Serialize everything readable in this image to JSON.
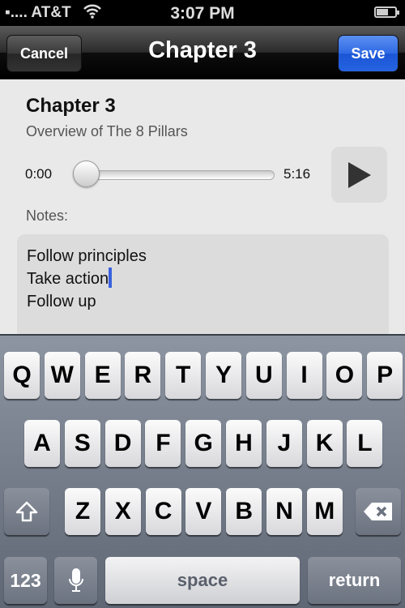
{
  "status_bar": {
    "carrier": "▪.... AT&T",
    "wifi_icon": "wifi-icon",
    "time": "3:07 PM",
    "battery_icon": "battery-icon"
  },
  "navbar": {
    "title": "Chapter 3",
    "cancel_label": "Cancel",
    "save_label": "Save",
    "save_color": "#2563e0"
  },
  "chapter": {
    "title": "Chapter 3",
    "subtitle": "Overview of The 8 Pillars"
  },
  "player": {
    "current_time": "0:00",
    "duration": "5:16",
    "progress": 0,
    "play_icon": "play-icon"
  },
  "notes": {
    "label": "Notes:",
    "lines": [
      "Follow principles",
      "Take action",
      "Follow up"
    ]
  },
  "keyboard": {
    "rows": [
      [
        "Q",
        "W",
        "E",
        "R",
        "T",
        "Y",
        "U",
        "I",
        "O",
        "P"
      ],
      [
        "A",
        "S",
        "D",
        "F",
        "G",
        "H",
        "J",
        "K",
        "L"
      ],
      [
        "Z",
        "X",
        "C",
        "V",
        "B",
        "N",
        "M"
      ]
    ],
    "shift_icon": "shift-icon",
    "backspace_icon": "backspace-icon",
    "numbers_label": "123",
    "mic_icon": "microphone-icon",
    "space_label": "space",
    "return_label": "return"
  }
}
